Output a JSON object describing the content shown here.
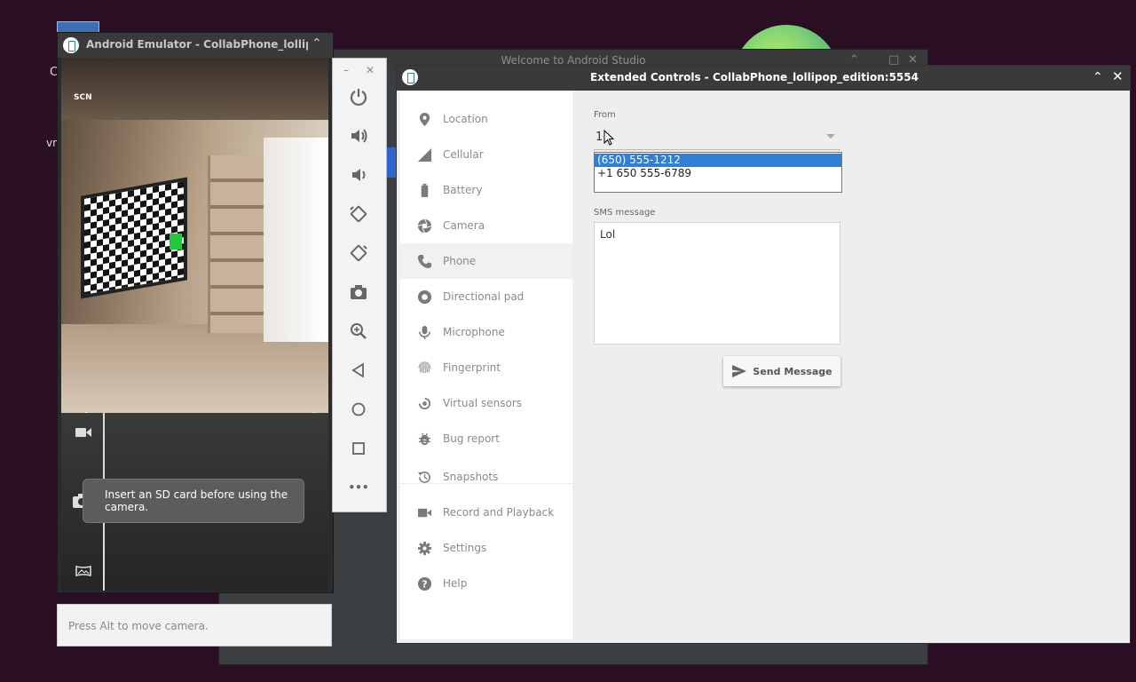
{
  "desktop": {
    "label_1": "C",
    "label_2": "vn"
  },
  "welcome_window": {
    "title": "Welcome to Android Studio"
  },
  "emulator": {
    "title": "Android Emulator - CollabPhone_lollipop_ec",
    "scene_mode_label": "SCN",
    "toast": "Insert an SD card before using the camera.",
    "hint": "Press Alt to move camera."
  },
  "toolbar": {
    "minimize": "–",
    "close": "✕",
    "more": "•••"
  },
  "extended_controls": {
    "title": "Extended Controls - CollabPhone_lollipop_edition:5554",
    "nav": [
      {
        "label": "Location",
        "icon": "location-pin-icon"
      },
      {
        "label": "Cellular",
        "icon": "signal-icon"
      },
      {
        "label": "Battery",
        "icon": "battery-icon"
      },
      {
        "label": "Camera",
        "icon": "camera-aperture-icon"
      },
      {
        "label": "Phone",
        "icon": "phone-icon",
        "selected": true
      },
      {
        "label": "Directional pad",
        "icon": "dpad-icon"
      },
      {
        "label": "Microphone",
        "icon": "microphone-icon"
      },
      {
        "label": "Fingerprint",
        "icon": "fingerprint-icon"
      },
      {
        "label": "Virtual sensors",
        "icon": "rotation-icon"
      },
      {
        "label": "Bug report",
        "icon": "bug-icon"
      },
      {
        "label": "Snapshots",
        "icon": "history-icon"
      },
      {
        "label": "Record and Playback",
        "icon": "videocam-icon"
      },
      {
        "label": "Settings",
        "icon": "gear-icon"
      },
      {
        "label": "Help",
        "icon": "help-icon"
      }
    ],
    "phone": {
      "from_label": "From",
      "from_value": "1",
      "from_options": [
        "(650) 555-1212",
        "+1 650 555-6789"
      ],
      "selected_option": "(650) 555-1212",
      "sms_label": "SMS message",
      "sms_value": "Lol",
      "send_button": "Send Message"
    }
  },
  "colors": {
    "desktop_bg": "#2a0f24",
    "selection": "#2f7ed8",
    "title_bar": "#3a3a3a"
  }
}
